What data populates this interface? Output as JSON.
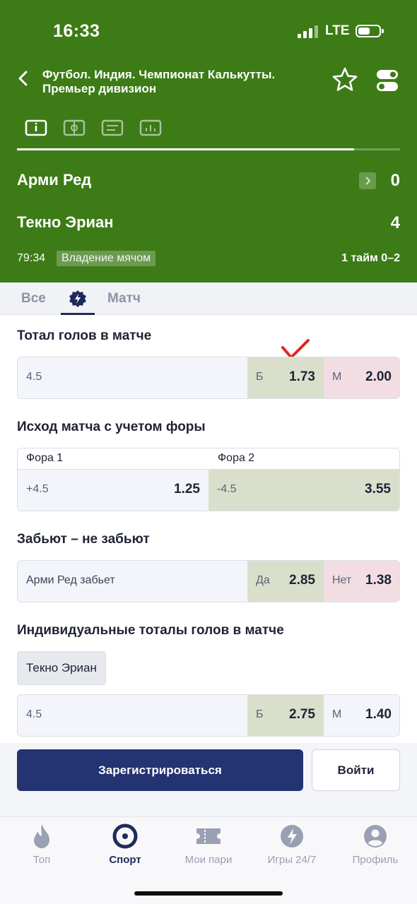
{
  "status": {
    "time": "16:33",
    "network": "LTE"
  },
  "header": {
    "title": "Футбол. Индия. Чемпионат Калькутты. Премьер дивизион",
    "icons": [
      "back-chevron-icon",
      "star-icon",
      "toggle-settings-icon"
    ],
    "view_tabs": [
      "info-icon",
      "field-icon",
      "list-icon",
      "stats-icon"
    ],
    "progress_fraction": 0.88
  },
  "match": {
    "team1": "Арми Ред",
    "team2": "Текно Эриан",
    "score1": "0",
    "score2": "4",
    "time": "79:34",
    "possession": "Владение мячом",
    "half": "1 тайм 0–2"
  },
  "tabs": {
    "all": "Все",
    "match": "Матч",
    "active_icon": "lightning-icon"
  },
  "markets": {
    "total": {
      "title": "Тотал голов в матче",
      "line": "4.5",
      "over_label": "Б",
      "over_odd": "1.73",
      "under_label": "М",
      "under_odd": "2.00"
    },
    "handicap": {
      "title": "Исход матча с учетом форы",
      "h1_label": "Фора 1",
      "h1_line": "+4.5",
      "h1_odd": "1.25",
      "h2_label": "Фора 2",
      "h2_line": "-4.5",
      "h2_odd": "3.55"
    },
    "score": {
      "title": "Забьют – не забьют",
      "label": "Арми Ред забьет",
      "yes_label": "Да",
      "yes_odd": "2.85",
      "no_label": "Нет",
      "no_odd": "1.38"
    },
    "individual": {
      "title": "Индивидуальные тоталы голов в матче",
      "team": "Текно Эриан",
      "line": "4.5",
      "over_label": "Б",
      "over_odd": "2.75",
      "under_label": "М",
      "under_odd": "1.40"
    }
  },
  "auth": {
    "register": "Зарегистрироваться",
    "login": "Войти"
  },
  "nav": [
    {
      "label": "Топ",
      "icon": "flame-icon"
    },
    {
      "label": "Спорт",
      "icon": "target-icon"
    },
    {
      "label": "Мои пари",
      "icon": "ticket-icon"
    },
    {
      "label": "Игры 24/7",
      "icon": "lightning-icon"
    },
    {
      "label": "Профиль",
      "icon": "profile-icon"
    }
  ],
  "colors": {
    "header_green": "#3d7b17",
    "primary_navy": "#243372",
    "odd_green": "#dadfcc",
    "odd_pink": "#f2dde3",
    "check_red": "#e0261c"
  }
}
